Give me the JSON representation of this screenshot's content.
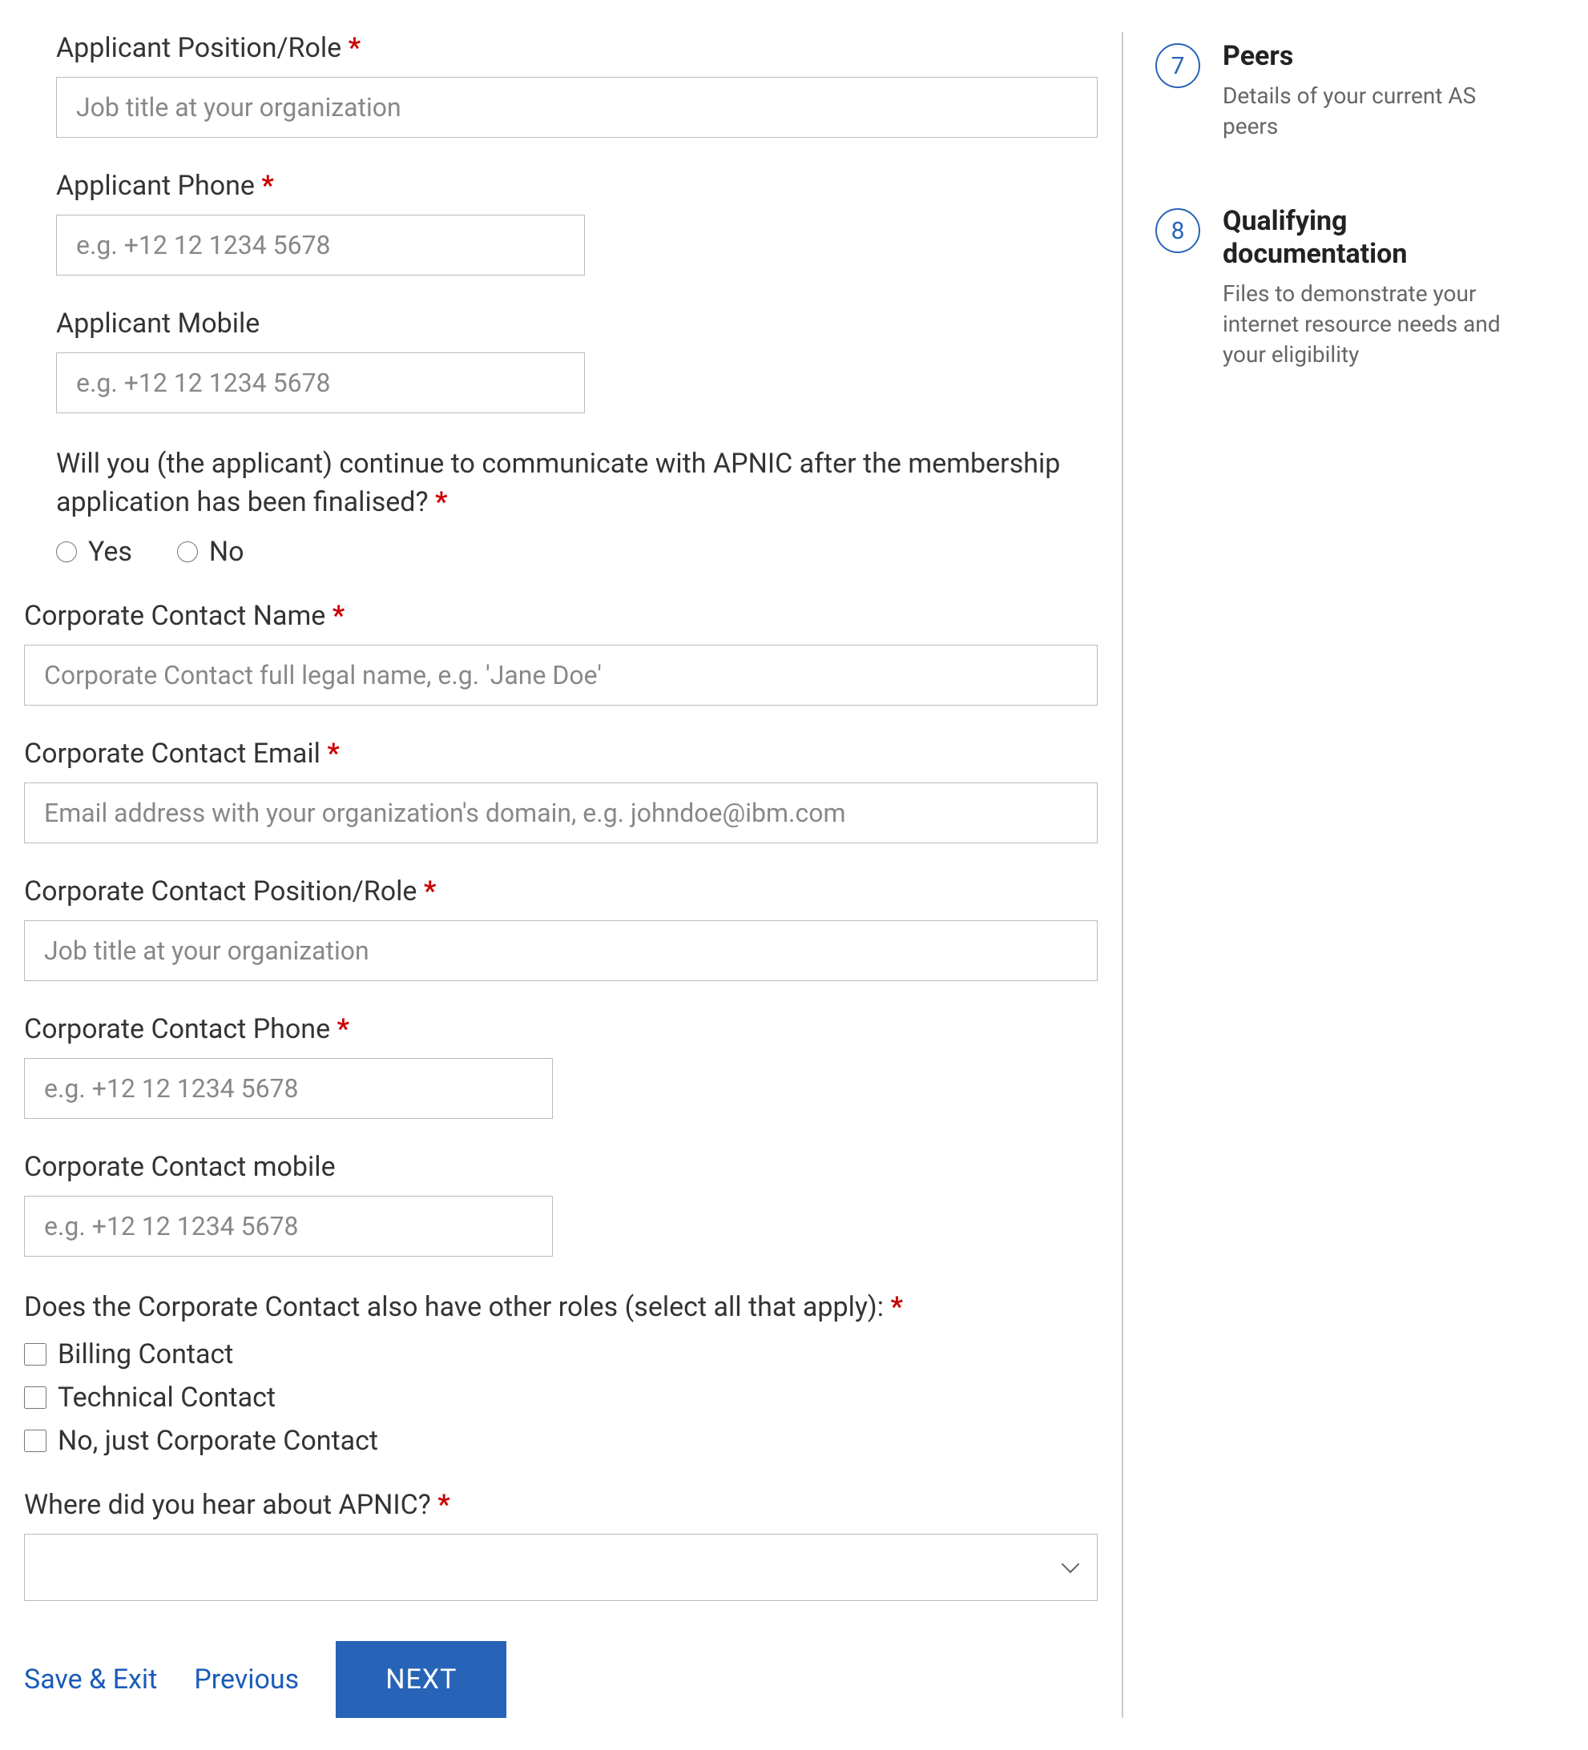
{
  "fields": {
    "applicant_role": {
      "label": "Applicant Position/Role",
      "placeholder": "Job title at your organization",
      "required": true
    },
    "applicant_phone": {
      "label": "Applicant Phone",
      "placeholder": "e.g. +12 12 1234 5678",
      "required": true
    },
    "applicant_mobile": {
      "label": "Applicant Mobile",
      "placeholder": "e.g. +12 12 1234 5678",
      "required": false
    },
    "continue_comm": {
      "label": "Will you (the applicant) continue to communicate with APNIC after the membership application has been finalised?",
      "required": true,
      "options": {
        "yes": "Yes",
        "no": "No"
      }
    },
    "corp_name": {
      "label": "Corporate Contact Name",
      "placeholder": "Corporate Contact full legal name, e.g. 'Jane Doe'",
      "required": true
    },
    "corp_email": {
      "label": "Corporate Contact Email",
      "placeholder": "Email address with your organization's domain, e.g. johndoe@ibm.com",
      "required": true
    },
    "corp_role": {
      "label": "Corporate Contact Position/Role",
      "placeholder": "Job title at your organization",
      "required": true
    },
    "corp_phone": {
      "label": "Corporate Contact Phone",
      "placeholder": "e.g. +12 12 1234 5678",
      "required": true
    },
    "corp_mobile": {
      "label": "Corporate Contact mobile",
      "placeholder": "e.g. +12 12 1234 5678",
      "required": false
    },
    "corp_other_roles": {
      "label": "Does the Corporate Contact also have other roles (select all that apply):",
      "required": true,
      "options": {
        "billing": "Billing Contact",
        "technical": "Technical Contact",
        "none": "No, just Corporate Contact"
      }
    },
    "hear_about": {
      "label": "Where did you hear about APNIC?",
      "required": true
    }
  },
  "required_marker": "*",
  "buttons": {
    "save_exit": "Save & Exit",
    "previous": "Previous",
    "next": "NEXT"
  },
  "steps": [
    {
      "num": "7",
      "title": "Peers",
      "desc": "Details of your current AS peers"
    },
    {
      "num": "8",
      "title": "Qualifying documentation",
      "desc": "Files to demonstrate your internet resource needs and your eligibility"
    }
  ]
}
